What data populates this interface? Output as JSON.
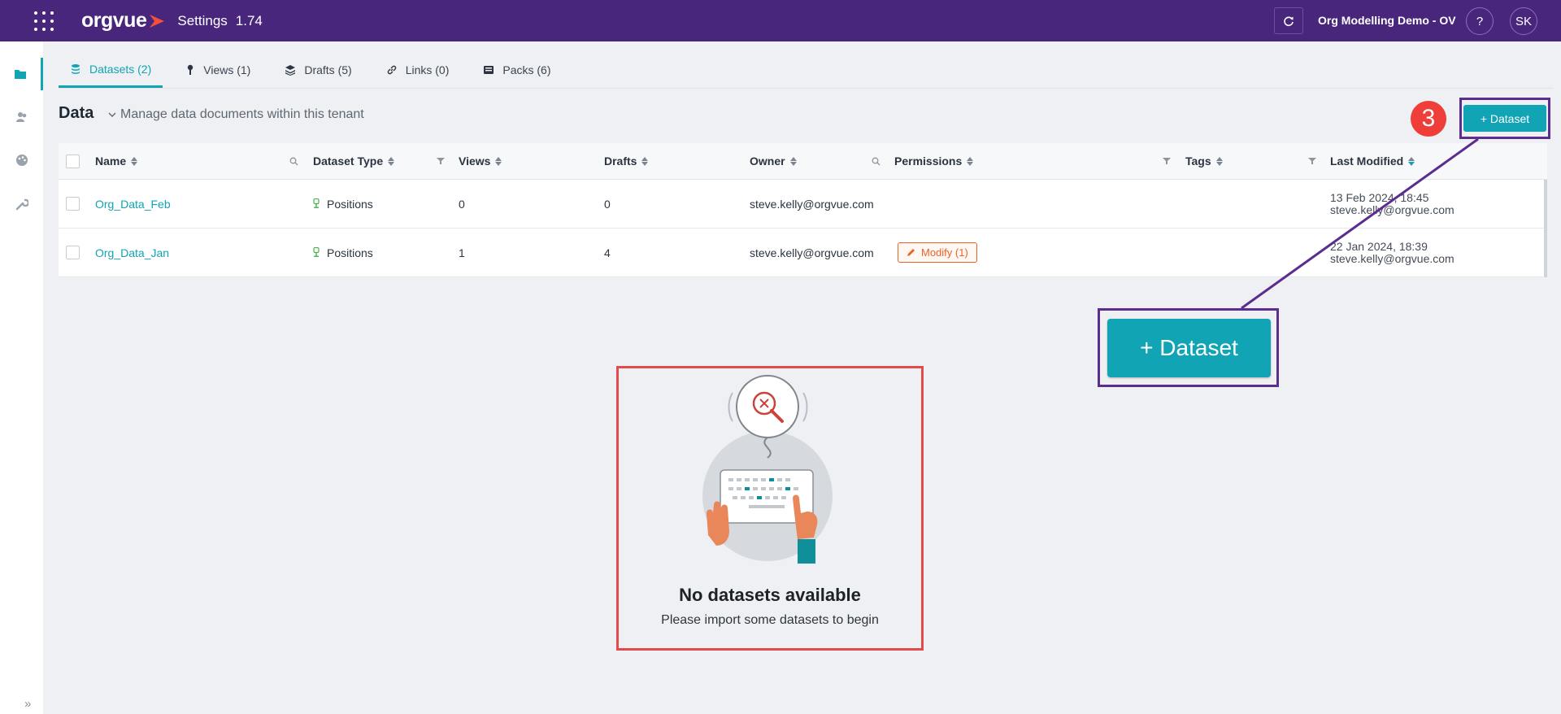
{
  "topbar": {
    "logo": "orgvue",
    "title": "Settings",
    "version": "1.74",
    "tenant": "Org Modelling Demo - OV",
    "help": "?",
    "user_initials": "SK"
  },
  "sidebar": {
    "items": [
      {
        "icon": "folder-icon"
      },
      {
        "icon": "users-icon"
      },
      {
        "icon": "palette-icon"
      },
      {
        "icon": "wrench-icon"
      }
    ],
    "collapse": "»"
  },
  "tabs": [
    {
      "label": "Datasets (2)",
      "icon": "database-icon",
      "active": true
    },
    {
      "label": "Views (1)",
      "icon": "pin-icon"
    },
    {
      "label": "Drafts (5)",
      "icon": "layers-icon"
    },
    {
      "label": "Links (0)",
      "icon": "link-icon"
    },
    {
      "label": "Packs (6)",
      "icon": "pack-icon"
    }
  ],
  "header": {
    "title": "Data",
    "description": "Manage data documents within this tenant",
    "add_button": "+ Dataset"
  },
  "table": {
    "columns": {
      "name": "Name",
      "dataset_type": "Dataset Type",
      "views": "Views",
      "drafts": "Drafts",
      "owner": "Owner",
      "permissions": "Permissions",
      "tags": "Tags",
      "last_modified": "Last Modified"
    },
    "rows": [
      {
        "name": "Org_Data_Feb",
        "dataset_type": "Positions",
        "views": "0",
        "drafts": "0",
        "owner": "steve.kelly@orgvue.com",
        "permissions": "",
        "modified_date": "13 Feb 2024, 18:45",
        "modified_by": "steve.kelly@orgvue.com"
      },
      {
        "name": "Org_Data_Jan",
        "dataset_type": "Positions",
        "views": "1",
        "drafts": "4",
        "owner": "steve.kelly@orgvue.com",
        "permissions": "Modify (1)",
        "modified_date": "22 Jan 2024, 18:39",
        "modified_by": "steve.kelly@orgvue.com"
      }
    ]
  },
  "annotation": {
    "step_number": "3",
    "zoom_button": "+ Dataset",
    "colors": {
      "frame": "#5b2d8e",
      "badge": "#ef3e39",
      "empty_frame": "#e34b4b"
    }
  },
  "empty_state": {
    "title": "No datasets available",
    "subtitle": "Please import some datasets to begin"
  },
  "colors": {
    "topbar": "#48267c",
    "accent": "#10a4b4",
    "permission": "#e8632b"
  }
}
